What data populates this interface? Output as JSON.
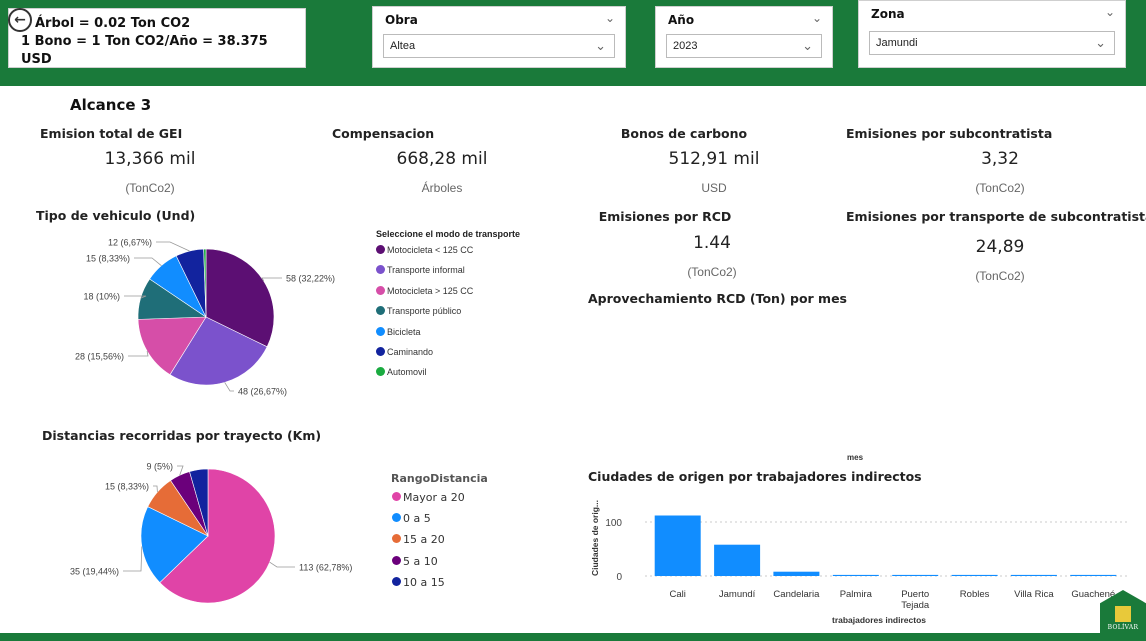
{
  "filters": {
    "info_line1": "Árbol = 0.02 Ton CO2",
    "info_line2": "1 Bono = 1 Ton CO2/Año = 38.375 USD",
    "obra": {
      "title": "Obra",
      "value": "Altea"
    },
    "anio": {
      "title": "Año",
      "value": "2023"
    },
    "zona": {
      "title": "Zona",
      "value": "Jamundi"
    }
  },
  "section_title": "Alcance 3",
  "cards": {
    "emision_total": {
      "title": "Emision total de GEI",
      "value": "13,366 mil",
      "unit": "(TonCo2)"
    },
    "compensacion": {
      "title": "Compensacion",
      "value": "668,28 mil",
      "unit": "Árboles"
    },
    "bonos": {
      "title": "Bonos de carbono",
      "value": "512,91 mil",
      "unit": "USD"
    },
    "subcontratista": {
      "title": "Emisiones por subcontratista",
      "value": "3,32",
      "unit": "(TonCo2)"
    },
    "rcd": {
      "title": "Emisiones por RCD",
      "value": "1.44",
      "unit": "(TonCo2)"
    },
    "transporte_sub": {
      "title": "Emisiones por transporte de subcontratista",
      "value": "24,89",
      "unit": "(TonCo2)"
    }
  },
  "aprovechamiento_title": "Aprovechamiento RCD (Ton) por mes",
  "mes_label": "mes",
  "colors": {
    "header_green": "#1a7a3a",
    "bar_blue": "#118dff"
  },
  "icons": {
    "back": "back-arrow-icon",
    "dropdown": "chevron-down-icon",
    "logo": "constructora-bolivar-logo"
  },
  "logo_text": "BOLÍVAR",
  "chart_data": [
    {
      "type": "pie",
      "title": "Tipo de vehiculo (Und)",
      "legend_title": "Seleccione el modo de transporte",
      "legend_position": "right",
      "categories": [
        "Motocicleta < 125 CC",
        "Transporte informal",
        "Motocicleta > 125 CC",
        "Transporte público",
        "Bicicleta",
        "Caminando",
        "Automovil"
      ],
      "values": [
        58,
        48,
        28,
        18,
        15,
        12,
        1
      ],
      "data_labels": [
        "58 (32,22%)",
        "48 (26,67%)",
        "28 (15,56%)",
        "18 (10%)",
        "15 (8,33%)",
        "12 (6,67%)",
        ""
      ],
      "colors": [
        "#5c0f73",
        "#7b52cc",
        "#d64ea8",
        "#1f6e78",
        "#118dff",
        "#12239e",
        "#1aab40"
      ]
    },
    {
      "type": "pie",
      "title": "Distancias recorridas por trayecto (Km)",
      "legend_title": "RangoDistancia",
      "legend_position": "right",
      "categories": [
        "Mayor a 20",
        "0 a 5",
        "15 a 20",
        "5 a 10",
        "10 a 15"
      ],
      "values": [
        113,
        35,
        15,
        9,
        8
      ],
      "data_labels": [
        "113 (62,78%)",
        "35 (19,44%)",
        "15 (8,33%)",
        "9 (5%)",
        ""
      ],
      "colors": [
        "#e044a7",
        "#118dff",
        "#e66c37",
        "#6b007b",
        "#12239e"
      ]
    },
    {
      "type": "bar",
      "title": "Ciudades de origen por trabajadores indirectos",
      "xlabel": "trabajadores indirectos",
      "ylabel": "Ciudades de orig...",
      "categories": [
        "Cali",
        "Jamundí",
        "Candelaria",
        "Palmira",
        "Puerto Tejada",
        "Robles",
        "Villa Rica",
        "Guachené"
      ],
      "values": [
        112,
        58,
        8,
        2,
        2,
        2,
        2,
        2
      ],
      "ylim": [
        0,
        125
      ],
      "yticks": [
        0,
        100
      ],
      "grid": true,
      "color": "#118dff"
    }
  ]
}
